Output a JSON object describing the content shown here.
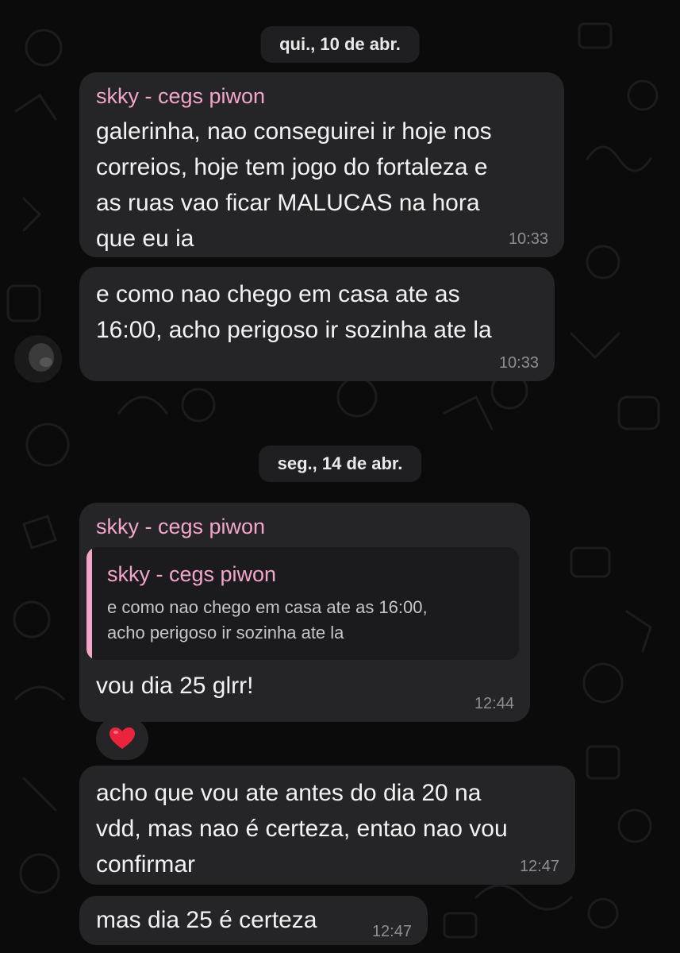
{
  "dates": [
    "qui., 10 de abr.",
    "seg., 14 de abr."
  ],
  "messages": [
    {
      "sender": "skky - cegs piwon",
      "text": "galerinha, nao conseguirei ir hoje nos\ncorreios, hoje tem jogo do fortaleza e\nas ruas vao ficar MALUCAS na hora\nque eu ia",
      "time": "10:33"
    },
    {
      "text": "e como nao chego em casa ate as\n16:00, acho perigoso ir sozinha ate la",
      "time": "10:33"
    },
    {
      "sender": "skky - cegs piwon",
      "quote": {
        "sender": "skky - cegs piwon",
        "text": "e como nao chego em casa ate as 16:00,\nacho perigoso ir sozinha ate la"
      },
      "text": "vou dia 25 glrr!",
      "time": "12:44",
      "reaction": "heart"
    },
    {
      "text": "acho que vou ate antes do dia 20 na\nvdd, mas nao é certeza, entao nao vou\nconfirmar",
      "time": "12:47"
    },
    {
      "text": "mas dia 25 é certeza",
      "time": "12:47"
    }
  ],
  "colors": {
    "background": "#0b0b0b",
    "bubble": "#252527",
    "sender_name": "#f3a6c9",
    "reaction_heart": "#e8253d"
  }
}
